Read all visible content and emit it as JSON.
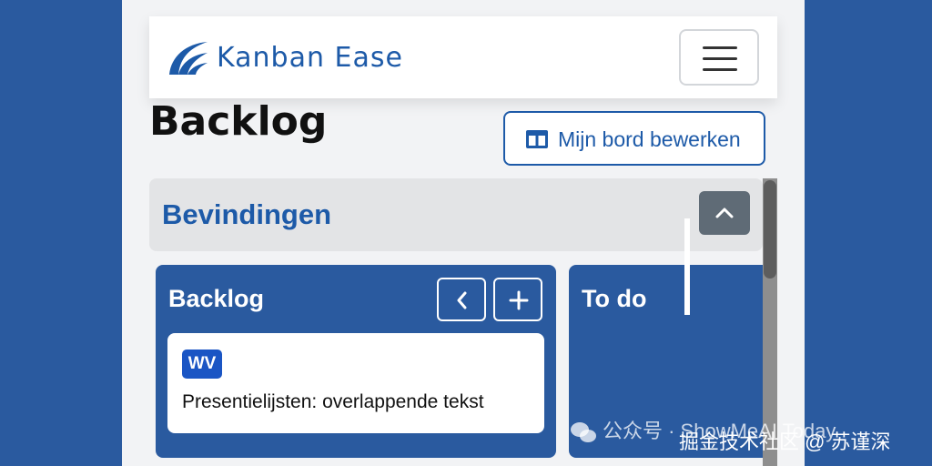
{
  "app": {
    "brand_name": "Kanban Ease"
  },
  "page": {
    "title": "Backlog",
    "edit_board_label": "Mijn bord bewerken"
  },
  "section": {
    "title": "Bevindingen"
  },
  "columns": [
    {
      "title": "Backlog",
      "cards": [
        {
          "badge": "WV",
          "text": "Presentielijsten: overlappende tekst"
        }
      ]
    },
    {
      "title": "To do"
    }
  ],
  "colors": {
    "primary": "#1d5aa8",
    "column_bg": "#2a5a9f",
    "badge": "#1a55c4",
    "section_bg": "#e3e4e6",
    "collapse_btn": "#5f6b76"
  },
  "icons": [
    "logo-icon",
    "hamburger-menu-icon",
    "board-columns-icon",
    "chevron-up-icon",
    "chevron-left-icon",
    "plus-icon",
    "wechat-icon"
  ],
  "watermark": {
    "line1": "公众号 · ShowMeAI Today",
    "line2": "掘金技术社区 @ 苏谨深"
  }
}
